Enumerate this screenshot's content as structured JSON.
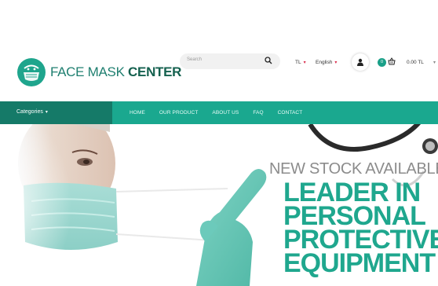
{
  "header": {
    "logo": {
      "text_light": "FACE MASK",
      "text_bold": "CENTER"
    },
    "search": {
      "placeholder": "Search"
    },
    "currency": {
      "selected": "TL"
    },
    "language": {
      "selected": "English"
    },
    "cart": {
      "count": "0",
      "total": "0.00 TL"
    }
  },
  "navbar": {
    "categories_label": "Categories",
    "items": [
      {
        "label": "HOME"
      },
      {
        "label": "OUR PRODUCT"
      },
      {
        "label": "ABOUT US"
      },
      {
        "label": "FAQ"
      },
      {
        "label": "CONTACT"
      }
    ]
  },
  "hero": {
    "subtitle": "NEW STOCK AVAILABLE",
    "title_lines": [
      "LEADER IN",
      "PERSONAL",
      "PROTECTIVE",
      "EQUIPMENT"
    ]
  },
  "colors": {
    "brand": "#1aa88f",
    "brand_dark": "#157a68",
    "accent_text": "#1fa78e",
    "caret": "#d92b4b"
  }
}
